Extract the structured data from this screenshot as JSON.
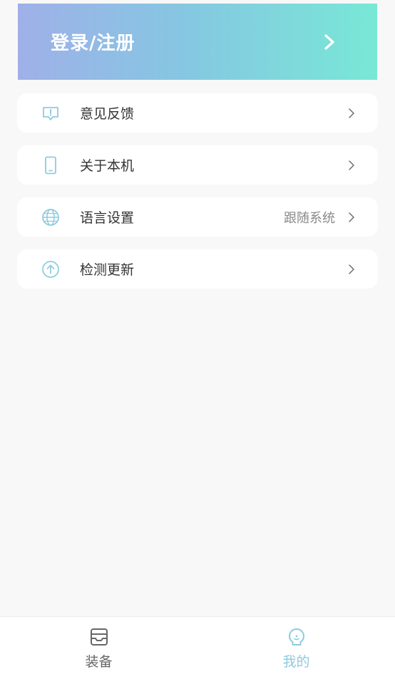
{
  "login": {
    "title": "登录/注册"
  },
  "menu": [
    {
      "label": "意见反馈",
      "icon": "feedback-icon"
    },
    {
      "label": "关于本机",
      "icon": "phone-icon"
    },
    {
      "label": "语言设置",
      "value": "跟随系统",
      "icon": "globe-icon"
    },
    {
      "label": "检测更新",
      "icon": "upload-icon"
    }
  ],
  "tabbar": {
    "tabs": [
      {
        "label": "装备",
        "icon": "inbox-icon",
        "active": false
      },
      {
        "label": "我的",
        "icon": "profile-icon",
        "active": true
      }
    ]
  },
  "colors": {
    "accent": "#8ccbe0",
    "gradient_start": "#9fb0e8",
    "gradient_end": "#78e8d6",
    "background": "#f8f8f8"
  }
}
